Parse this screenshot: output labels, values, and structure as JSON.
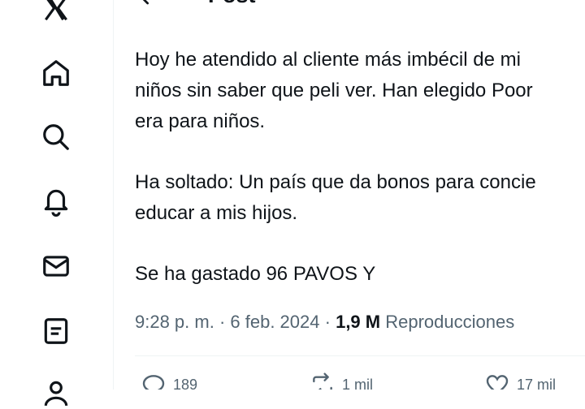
{
  "header": {
    "title": "Post"
  },
  "tweet": {
    "paragraphs": [
      [
        "Hoy he atendido al cliente más imbécil de mi",
        "niños sin saber que peli ver. Han elegido Poor",
        "era para niños."
      ],
      [
        "Ha soltado: Un país que da bonos para concie",
        "educar a mis hijos."
      ],
      [
        "Se ha  gastado 96 PAVOS Y"
      ]
    ]
  },
  "meta": {
    "time": "9:28 p. m.",
    "sep1": " · ",
    "date": "6 feb. 2024",
    "sep2": " · ",
    "views_count": "1,9 M",
    "views_label": " Reproducciones"
  },
  "actions": {
    "replies": "189",
    "reposts": "1 mil",
    "likes": "17 mil"
  },
  "nav_icons": [
    "x-logo-icon",
    "home-icon",
    "search-icon",
    "notifications-bell-icon",
    "messages-mail-icon",
    "lists-icon",
    "profile-icon"
  ]
}
